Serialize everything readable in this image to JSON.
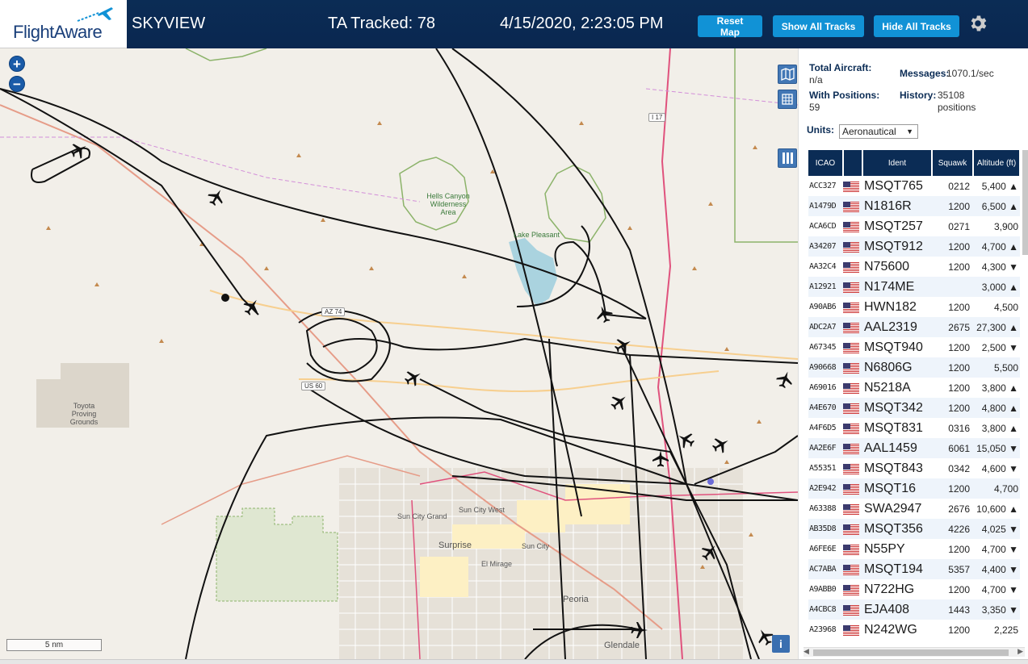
{
  "header": {
    "logo_text": "FlightAware",
    "title": "SKYVIEW",
    "tracked": "TA Tracked: 78",
    "datetime": "4/15/2020, 2:23:05 PM",
    "buttons": {
      "reset": "Reset Map",
      "show": "Show All Tracks",
      "hide": "Hide All Tracks"
    },
    "accent": "#1192d6",
    "bg": "#0b2c55"
  },
  "map": {
    "zoom_in": "+",
    "zoom_out": "−",
    "scale": "5 nm",
    "info": "i",
    "labels": {
      "hells_canyon": "Hells Canyon Wilderness Area",
      "lake_pleasant": "Lake Pleasant",
      "toyota": "Toyota Proving Grounds",
      "sun_city_grand": "Sun City Grand",
      "sun_city_west": "Sun City West",
      "surprise": "Surprise",
      "sun_city": "Sun City",
      "el_mirage": "El Mirage",
      "peoria": "Peoria",
      "glendale": "Glendale",
      "az74": "AZ 74",
      "us60": "US 60",
      "i17": "I 17"
    }
  },
  "stats": {
    "total_label": "Total Aircraft:",
    "total_value": "n/a",
    "messages_label": "Messages:",
    "messages_value": "1070.1/sec",
    "positions_label": "With Positions:",
    "positions_value": "59",
    "history_label": "History:",
    "history_value": "35108 positions"
  },
  "units": {
    "label": "Units:",
    "selected": "Aeronautical"
  },
  "table": {
    "headers": [
      "ICAO",
      "",
      "Ident",
      "Squawk",
      "Altitude (ft)"
    ],
    "rows": [
      {
        "icao": "ACC327",
        "ident": "MSQT765",
        "squawk": "0212",
        "alt": "5,400 ▲"
      },
      {
        "icao": "A1479D",
        "ident": "N1816R",
        "squawk": "1200",
        "alt": "6,500 ▲"
      },
      {
        "icao": "ACA6CD",
        "ident": "MSQT257",
        "squawk": "0271",
        "alt": "3,900"
      },
      {
        "icao": "A34207",
        "ident": "MSQT912",
        "squawk": "1200",
        "alt": "4,700 ▲"
      },
      {
        "icao": "AA32C4",
        "ident": "N75600",
        "squawk": "1200",
        "alt": "4,300 ▼"
      },
      {
        "icao": "A12921",
        "ident": "N174ME",
        "squawk": "",
        "alt": "3,000 ▲"
      },
      {
        "icao": "A90AB6",
        "ident": "HWN182",
        "squawk": "1200",
        "alt": "4,500"
      },
      {
        "icao": "ADC2A7",
        "ident": "AAL2319",
        "squawk": "2675",
        "alt": "27,300 ▲"
      },
      {
        "icao": "A67345",
        "ident": "MSQT940",
        "squawk": "1200",
        "alt": "2,500 ▼"
      },
      {
        "icao": "A90668",
        "ident": "N6806G",
        "squawk": "1200",
        "alt": "5,500"
      },
      {
        "icao": "A69016",
        "ident": "N5218A",
        "squawk": "1200",
        "alt": "3,800 ▲"
      },
      {
        "icao": "A4E670",
        "ident": "MSQT342",
        "squawk": "1200",
        "alt": "4,800 ▲"
      },
      {
        "icao": "A4F6D5",
        "ident": "MSQT831",
        "squawk": "0316",
        "alt": "3,800 ▲"
      },
      {
        "icao": "AA2E6F",
        "ident": "AAL1459",
        "squawk": "6061",
        "alt": "15,050 ▼"
      },
      {
        "icao": "A55351",
        "ident": "MSQT843",
        "squawk": "0342",
        "alt": "4,600 ▼"
      },
      {
        "icao": "A2E942",
        "ident": "MSQT16",
        "squawk": "1200",
        "alt": "4,700"
      },
      {
        "icao": "A63388",
        "ident": "SWA2947",
        "squawk": "2676",
        "alt": "10,600 ▲"
      },
      {
        "icao": "AB35D8",
        "ident": "MSQT356",
        "squawk": "4226",
        "alt": "4,025 ▼"
      },
      {
        "icao": "A6FE6E",
        "ident": "N55PY",
        "squawk": "1200",
        "alt": "4,700 ▼"
      },
      {
        "icao": "AC7ABA",
        "ident": "MSQT194",
        "squawk": "5357",
        "alt": "4,400 ▼"
      },
      {
        "icao": "A9ABB0",
        "ident": "N722HG",
        "squawk": "1200",
        "alt": "4,700 ▼"
      },
      {
        "icao": "A4CBC8",
        "ident": "EJA408",
        "squawk": "1443",
        "alt": "3,350 ▼"
      },
      {
        "icao": "A23968",
        "ident": "N242WG",
        "squawk": "1200",
        "alt": "2,225"
      }
    ]
  }
}
